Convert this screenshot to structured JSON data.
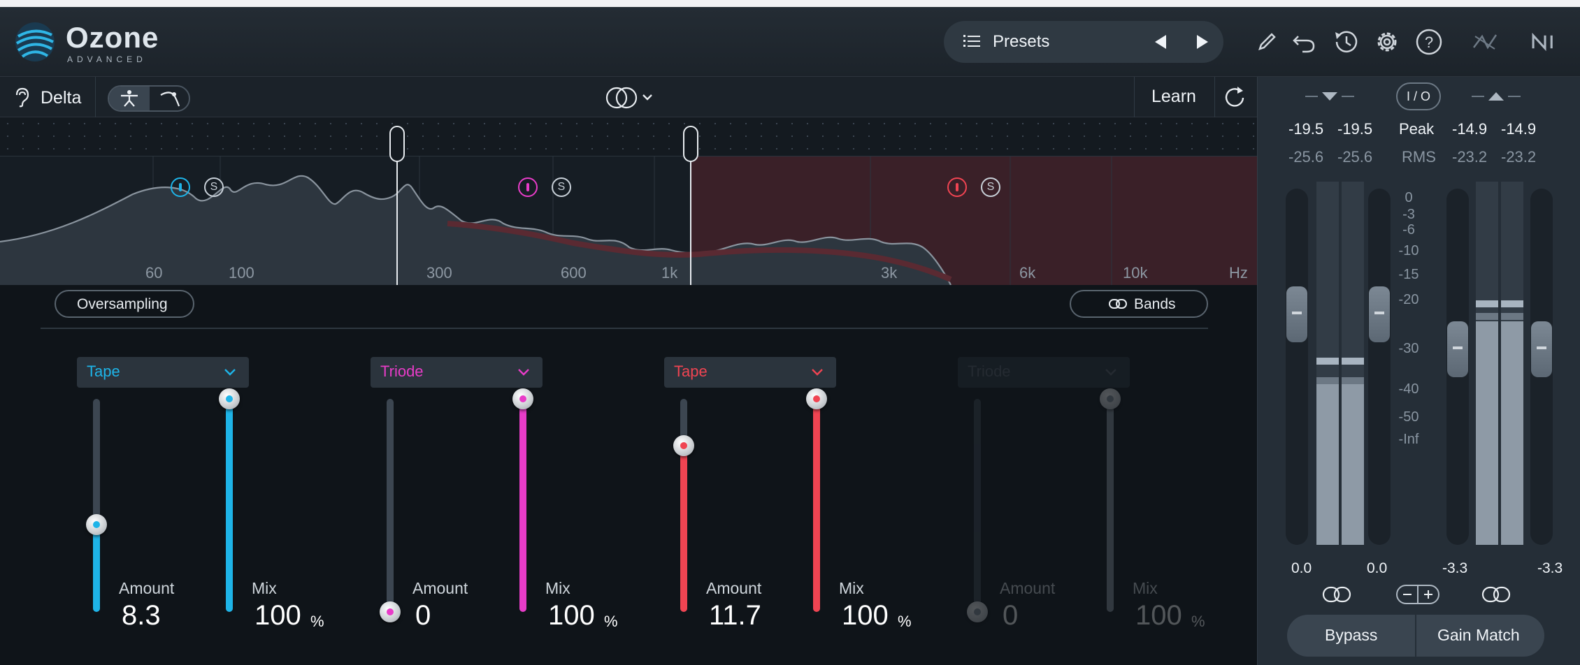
{
  "header": {
    "app_name": "Ozone",
    "app_edition": "ADVANCED",
    "presets_label": "Presets",
    "icons": [
      "list-icon",
      "prev-arrow-icon",
      "next-arrow-icon",
      "pencil-icon",
      "undo-icon",
      "history-icon",
      "gear-icon",
      "help-icon",
      "signal-chain-icon",
      "ni-logo"
    ]
  },
  "module_bar": {
    "delta_label": "Delta",
    "learn_label": "Learn"
  },
  "spectrum": {
    "freq_labels": [
      "60",
      "100",
      "300",
      "600",
      "1k",
      "3k",
      "6k",
      "10k",
      "Hz"
    ],
    "bands": [
      {
        "id": "band-1",
        "color": "#1eb4e8",
        "solo": "S"
      },
      {
        "id": "band-2",
        "color": "#e83cc8",
        "solo": "S"
      },
      {
        "id": "band-3",
        "color": "#f04452",
        "solo": "S"
      }
    ]
  },
  "controls": {
    "oversampling_label": "Oversampling",
    "bands_label": "Bands",
    "bands": [
      {
        "type": "Tape",
        "color": "#1eb4e8",
        "amount_label": "Amount",
        "amount": "8.3",
        "amount_level": 0.41,
        "mix_label": "Mix",
        "mix": "100",
        "mix_level": 1.0,
        "unit": "%",
        "enabled": true
      },
      {
        "type": "Triode",
        "color": "#e83cc8",
        "amount_label": "Amount",
        "amount": "0",
        "amount_level": 0.0,
        "mix_label": "Mix",
        "mix": "100",
        "mix_level": 1.0,
        "unit": "%",
        "enabled": true
      },
      {
        "type": "Tape",
        "color": "#f04452",
        "amount_label": "Amount",
        "amount": "11.7",
        "amount_level": 0.78,
        "mix_label": "Mix",
        "mix": "100",
        "mix_level": 1.0,
        "unit": "%",
        "enabled": true
      },
      {
        "type": "Triode",
        "color": "#8a96a2",
        "amount_label": "Amount",
        "amount": "0",
        "amount_level": 0.0,
        "mix_label": "Mix",
        "mix": "100",
        "mix_level": 1.0,
        "unit": "%",
        "enabled": false
      }
    ]
  },
  "meters": {
    "io_label": "I / O",
    "peak_label": "Peak",
    "rms_label": "RMS",
    "input": {
      "peak_l": "-19.5",
      "peak_r": "-19.5",
      "rms_l": "-25.6",
      "rms_r": "-25.6",
      "gain_l": "0.0",
      "gain_r": "0.0"
    },
    "output": {
      "peak_l": "-14.9",
      "peak_r": "-14.9",
      "rms_l": "-23.2",
      "rms_r": "-23.2",
      "gain_l": "-3.3",
      "gain_r": "-3.3"
    },
    "scale": [
      "0",
      "-3",
      "-6",
      "-10",
      "-15",
      "-20",
      "-30",
      "-40",
      "-50",
      "-Inf"
    ],
    "bypass_label": "Bypass",
    "gain_match_label": "Gain Match"
  }
}
